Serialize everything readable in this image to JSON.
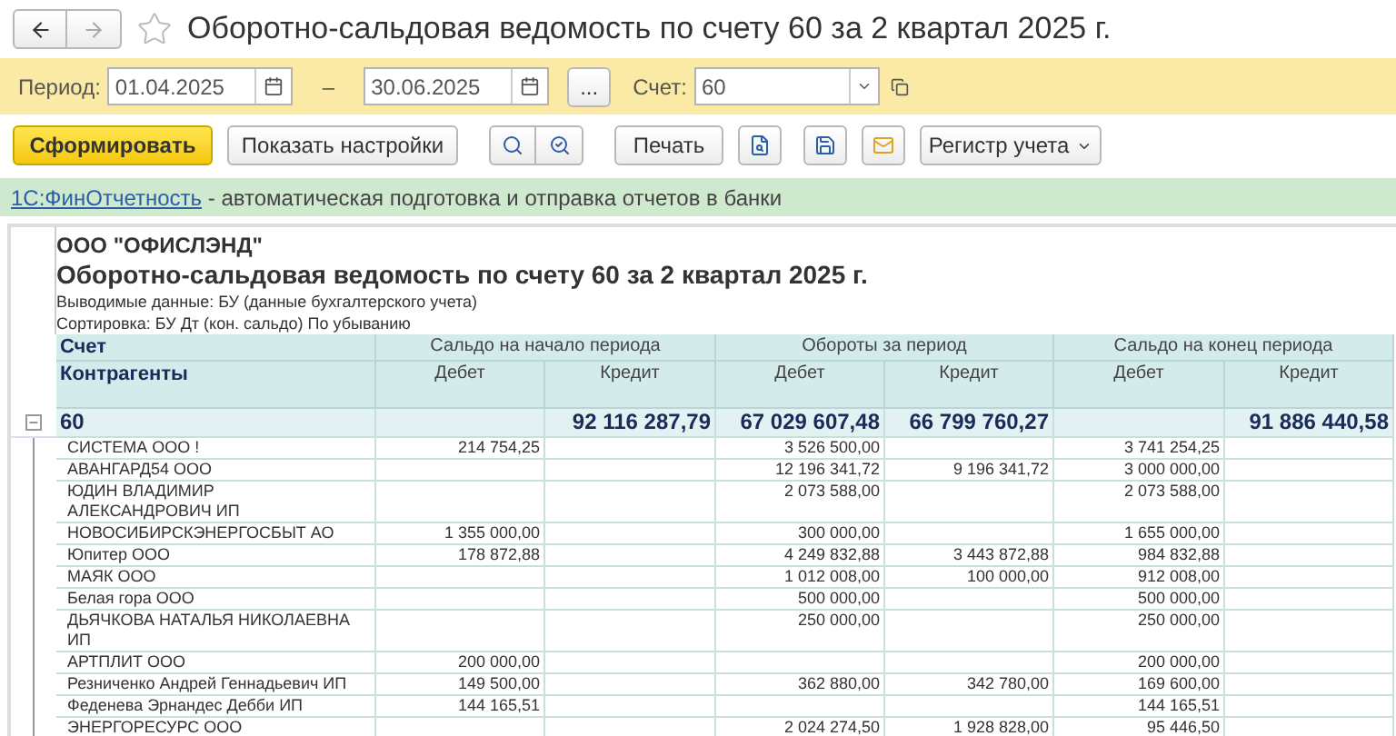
{
  "window": {
    "title": "Оборотно-сальдовая ведомость по счету 60 за 2 квартал 2025 г.",
    "favorite": false
  },
  "period": {
    "label": "Период:",
    "from": "01.04.2025",
    "dash": "–",
    "to": "30.06.2025",
    "more": "...",
    "account_label": "Счет:",
    "account": "60"
  },
  "toolbar": {
    "generate": "Сформировать",
    "settings": "Показать настройки",
    "print": "Печать",
    "register": "Регистр учета"
  },
  "banner": {
    "link": "1С:ФинОтчетность",
    "text": " - автоматическая подготовка и отправка отчетов в банки"
  },
  "report": {
    "company": "ООО \"ОФИСЛЭНД\"",
    "title": "Оборотно-сальдовая ведомость по счету 60 за 2 квартал 2025 г.",
    "output": "Выводимые данные: БУ (данные бухгалтерского учета)",
    "sorting": "Сортировка: БУ Дт (кон. сальдо) По убыванию",
    "header": {
      "col1_top": "Счет",
      "col1_bottom": "Контрагенты",
      "groups": [
        "Сальдо на начало периода",
        "Обороты за период",
        "Сальдо на конец периода"
      ],
      "sub": [
        "Дебет",
        "Кредит",
        "Дебет",
        "Кредит",
        "Дебет",
        "Кредит"
      ]
    },
    "total": {
      "account": "60",
      "expanded": true,
      "opening_credit": "92 116 287,79",
      "turnover_debit": "67 029 607,48",
      "turnover_credit": "66 799 760,27",
      "closing_credit": "91 886 440,58"
    },
    "rows": [
      {
        "name": "СИСТЕМА ООО !",
        "opening_debit": "214 754,25",
        "turnover_debit": "3 526 500,00",
        "closing_debit": "3 741 254,25"
      },
      {
        "name": "АВАНГАРД54 ООО",
        "turnover_debit": "12 196 341,72",
        "turnover_credit": "9 196 341,72",
        "closing_debit": "3 000 000,00"
      },
      {
        "name": "ЮДИН ВЛАДИМИР АЛЕКСАНДРОВИЧ ИП",
        "turnover_debit": "2 073 588,00",
        "closing_debit": "2 073 588,00"
      },
      {
        "name": "НОВОСИБИРСКЭНЕРГОСБЫТ АО",
        "opening_debit": "1 355 000,00",
        "turnover_debit": "300 000,00",
        "closing_debit": "1 655 000,00"
      },
      {
        "name": "Юпитер ООО",
        "opening_debit": "178 872,88",
        "turnover_debit": "4 249 832,88",
        "turnover_credit": "3 443 872,88",
        "closing_debit": "984 832,88"
      },
      {
        "name": "МАЯК ООО",
        "turnover_debit": "1 012 008,00",
        "turnover_credit": "100 000,00",
        "closing_debit": "912 008,00"
      },
      {
        "name": "Белая гора ООО",
        "turnover_debit": "500 000,00",
        "closing_debit": "500 000,00"
      },
      {
        "name": "ДЬЯЧКОВА НАТАЛЬЯ НИКОЛАЕВНА ИП",
        "turnover_debit": "250 000,00",
        "closing_debit": "250 000,00"
      },
      {
        "name": "АРТПЛИТ ООО",
        "opening_debit": "200 000,00",
        "closing_debit": "200 000,00"
      },
      {
        "name": "Резниченко Андрей Геннадьевич ИП",
        "opening_debit": "149 500,00",
        "turnover_debit": "362 880,00",
        "turnover_credit": "342 780,00",
        "closing_debit": "169 600,00"
      },
      {
        "name": "Феденева Эрнандес Дебби ИП",
        "opening_debit": "144 165,51",
        "closing_debit": "144 165,51"
      },
      {
        "name": "ЭНЕРГОРЕСУРС ООО",
        "turnover_debit": "2 024 274,50",
        "turnover_credit": "1 928 828,00",
        "closing_debit": "95 446,50"
      }
    ]
  }
}
